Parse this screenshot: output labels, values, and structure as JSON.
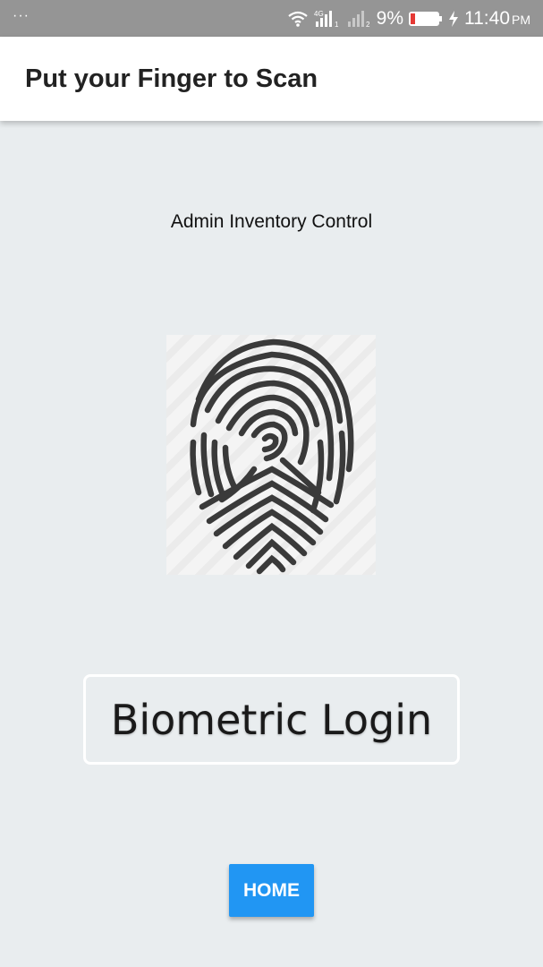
{
  "status_bar": {
    "notification_dots": "···",
    "network_label": "4G",
    "sim1_label": "1",
    "sim2_label": "2",
    "battery": "9%",
    "time": "11:40",
    "time_suffix": "PM",
    "icons": [
      "wifi-icon",
      "signal-icon",
      "battery-icon",
      "charging-icon"
    ],
    "battery_level": 0.09,
    "battery_color": "#e53935"
  },
  "app_bar": {
    "title": "Put your Finger to Scan"
  },
  "main": {
    "subtitle": "Admin Inventory Control",
    "fingerprint_icon": "fingerprint-icon",
    "login_label": "Biometric Login",
    "home_button_label": "HOME"
  },
  "colors": {
    "background": "#e9edef",
    "status_bar": "#959595",
    "accent": "#2196f3"
  }
}
